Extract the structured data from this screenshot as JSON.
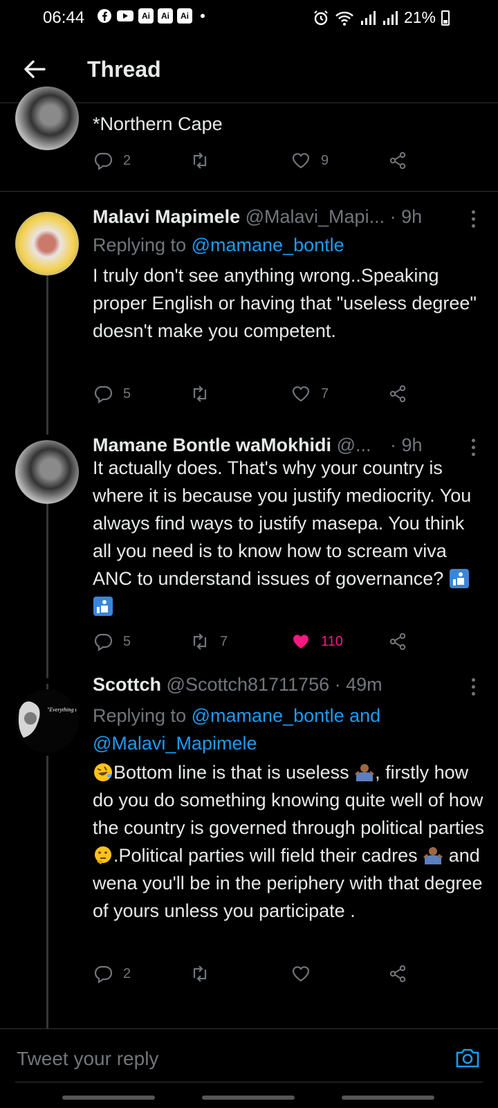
{
  "status_bar": {
    "time": "06:44",
    "battery": "21%",
    "badges": [
      "Ai",
      "Ai",
      "Ai"
    ]
  },
  "header": {
    "title": "Thread"
  },
  "tweets": [
    {
      "body": "*Northern Cape",
      "replies": "2",
      "retweets": "",
      "likes": "9",
      "liked": false
    },
    {
      "name": "Malavi Mapimele",
      "handle": "@Malavi_Mapi...",
      "time": "· 9h",
      "replying_prefix": "Replying to",
      "replying_to": "@mamane_bontle",
      "body": "I truly don't see anything wrong..Speaking proper English or having that \"useless degree\" doesn't make you competent.",
      "replies": "5",
      "retweets": "",
      "likes": "7",
      "liked": false
    },
    {
      "name": "Mamane Bontle waMokhidi",
      "handle": "@...",
      "time": "· 9h",
      "body": "It actually does. That's why your country is where it is because you justify mediocrity. You always find ways to justify masepa. You think all you need is to know how to scream viva ANC  to understand issues of governance?",
      "replies": "5",
      "retweets": "7",
      "likes": "110",
      "liked": true
    },
    {
      "name": "Scottch",
      "handle": "@Scottch81711756",
      "time": "· 49m",
      "replying_prefix": "Replying to",
      "replying_to": "@mamane_bontle and",
      "replying_to_2": "@Malavi_Mapimele",
      "body_1": "Bottom line is that is useless ",
      "body_2": ", firstly how do you do something knowing quite well of how the country is governed through political parties ",
      "body_3": ".Political parties will field their cadres ",
      "body_4": " and wena you'll be in the periphery with that degree of yours unless you participate .",
      "avatar_text": "\"Everything i Life is Vibra",
      "replies": "2",
      "retweets": "",
      "likes": "",
      "liked": false
    }
  ],
  "reply_bar": {
    "placeholder": "Tweet your reply"
  },
  "colors": {
    "accent": "#1d9bf0",
    "like": "#f91880",
    "muted": "#71767b",
    "background": "#000000"
  }
}
